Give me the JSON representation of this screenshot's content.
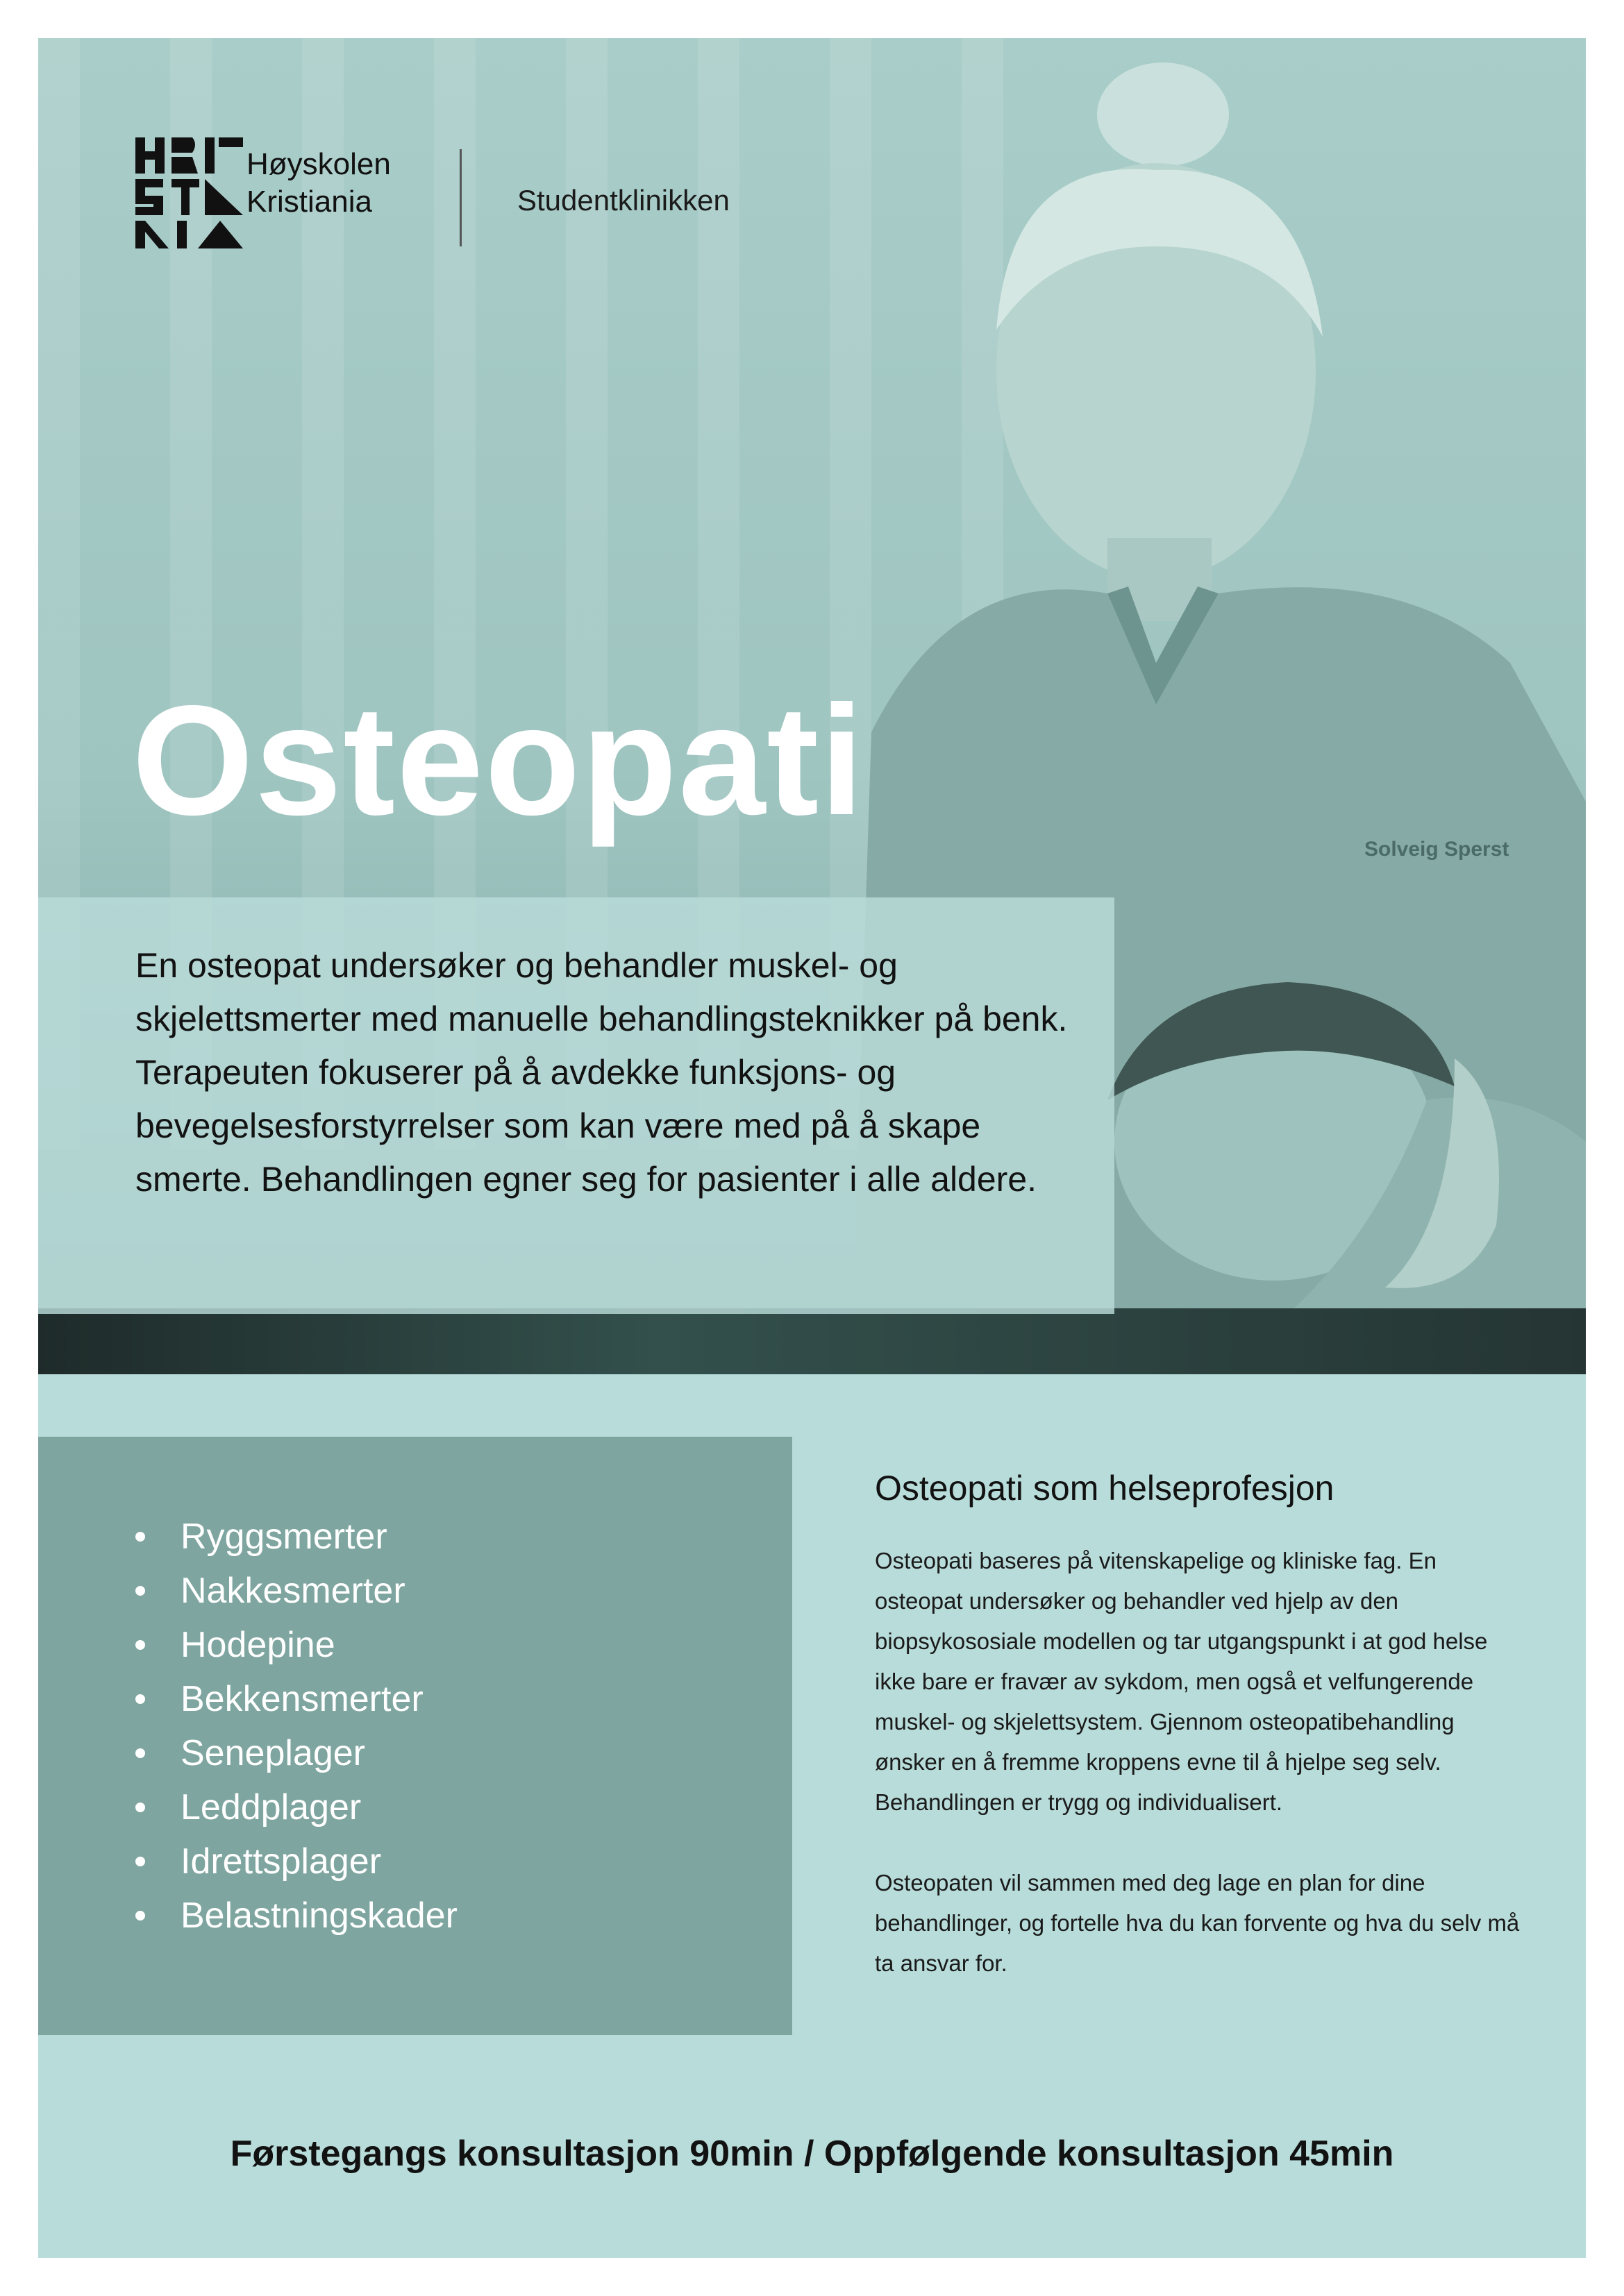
{
  "header": {
    "brand_line1": "Høyskolen",
    "brand_line2": "Kristiania",
    "clinic_name": "Studentklinikken"
  },
  "hero": {
    "title": "Osteopati",
    "intro": "En osteopat undersøker og behandler muskel- og skjelettsmerter med manuelle behandlingsteknikker på benk. Terapeuten fokuserer på å avdekke funksjons- og bevegelsesforstyrrelser som kan være med på å skape smerte. Behandlingen egner seg for pasienter i alle aldere.",
    "name_tag": "Solveig Sperst"
  },
  "conditions": {
    "items": [
      "Ryggsmerter",
      "Nakkesmerter",
      "Hodepine",
      "Bekkensmerter",
      "Seneplager",
      "Leddplager",
      "Idrettsplager",
      "Belastningskader"
    ]
  },
  "profession": {
    "heading": "Osteopati som helseprofesjon",
    "paragraph1": "Osteopati baseres på vitenskapelige og kliniske fag. En osteopat undersøker og behandler ved hjelp av den biopsykososiale modellen og tar utgangspunkt i at god helse ikke bare er fravær av sykdom, men også et velfungerende muskel- og skjelettsystem. Gjennom osteopatibehandling ønsker en å fremme kroppens evne til å hjelpe seg selv. Behandlingen er trygg og individualisert.",
    "paragraph2": "Osteopaten vil sammen med deg lage en plan for dine behandlinger, og fortelle hva du kan forvente og hva du selv må ta ansvar for."
  },
  "footer": {
    "consultation": "Førstegangs konsultasjon 90min / Oppfølgende konsultasjon 45min"
  },
  "colors": {
    "background": "#b8dcda",
    "list_panel": "#7ea59f",
    "title": "#ffffff"
  }
}
